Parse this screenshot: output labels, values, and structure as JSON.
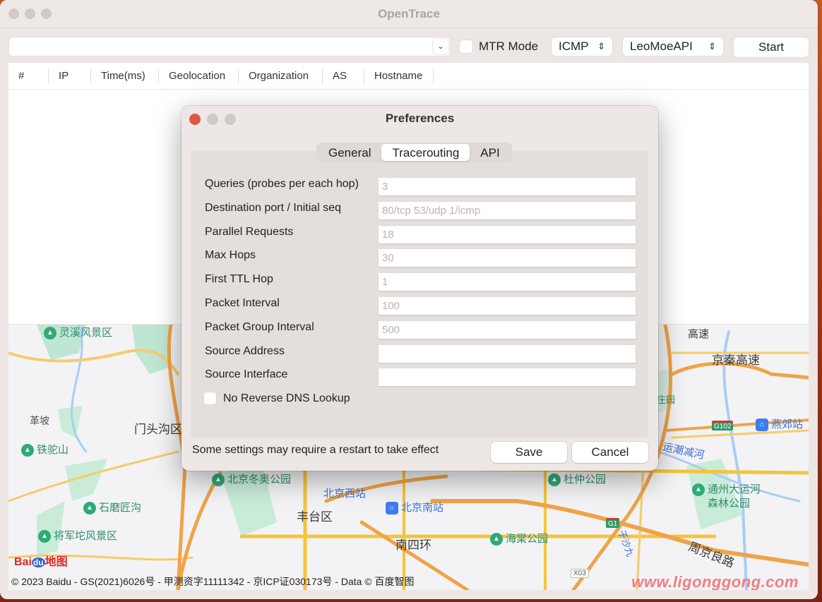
{
  "window": {
    "title": "OpenTrace"
  },
  "toolbar": {
    "host_value": "",
    "mtr_mode_label": "MTR Mode",
    "mtr_mode_checked": false,
    "protocol_selected": "ICMP",
    "api_selected": "LeoMoeAPI",
    "start_label": "Start"
  },
  "table": {
    "columns": [
      "#",
      "IP",
      "Time(ms)",
      "Geolocation",
      "Organization",
      "AS",
      "Hostname"
    ],
    "rows": []
  },
  "map": {
    "labels": {
      "l1": "灵溪风景区",
      "l2": "革坡",
      "l3": "门头沟区",
      "l4": "铁驼山",
      "l5": "石磨匠沟",
      "l6": "将军坨风景区",
      "l7": "北京冬奥公园",
      "l8": "北京西站",
      "l9": "丰台区",
      "l10": "北京南站",
      "l11": "南四环",
      "l12": "海棠公园",
      "l13": "杜仲公园",
      "l14": "通州大运河",
      "l14b": "森林公园",
      "l15": "周京良路",
      "l16": "京秦高速",
      "l17": "燕郊站",
      "l18": "运潮减河",
      "l19": "子沙九",
      "l20": "高速",
      "l21": "庄园"
    },
    "road_badges": {
      "g1": "G1",
      "g102": "G102",
      "x03": "X03"
    },
    "logo": {
      "bai": "Bai",
      "du": "du",
      "ditu": "地图"
    },
    "copyright": "© 2023 Baidu - GS(2021)6026号 - 甲测资字11111342 - 京ICP证030173号 - Data © 百度智图",
    "watermark": "www.ligonggong.com"
  },
  "dialog": {
    "title": "Preferences",
    "tabs": [
      {
        "label": "General",
        "active": false
      },
      {
        "label": "Tracerouting",
        "active": true
      },
      {
        "label": "API",
        "active": false
      }
    ],
    "fields": [
      {
        "label": "Queries (probes per each hop)",
        "value": "",
        "placeholder": "3"
      },
      {
        "label": "Destination port / Initial seq",
        "value": "",
        "placeholder": "80/tcp 53/udp 1/icmp"
      },
      {
        "label": "Parallel Requests",
        "value": "",
        "placeholder": "18"
      },
      {
        "label": "Max Hops",
        "value": "",
        "placeholder": "30"
      },
      {
        "label": "First TTL Hop",
        "value": "",
        "placeholder": "1"
      },
      {
        "label": "Packet Interval",
        "value": "",
        "placeholder": "100"
      },
      {
        "label": "Packet Group Interval",
        "value": "",
        "placeholder": "500"
      },
      {
        "label": "Source Address",
        "value": "",
        "placeholder": ""
      },
      {
        "label": "Source Interface",
        "value": "",
        "placeholder": ""
      }
    ],
    "no_rdns_label": "No Reverse DNS Lookup",
    "no_rdns_checked": false,
    "restart_note": "Some settings may require a restart to take effect",
    "save_label": "Save",
    "cancel_label": "Cancel"
  },
  "icons": {
    "dropdown": "⌄",
    "updown": "⌃⌄"
  }
}
